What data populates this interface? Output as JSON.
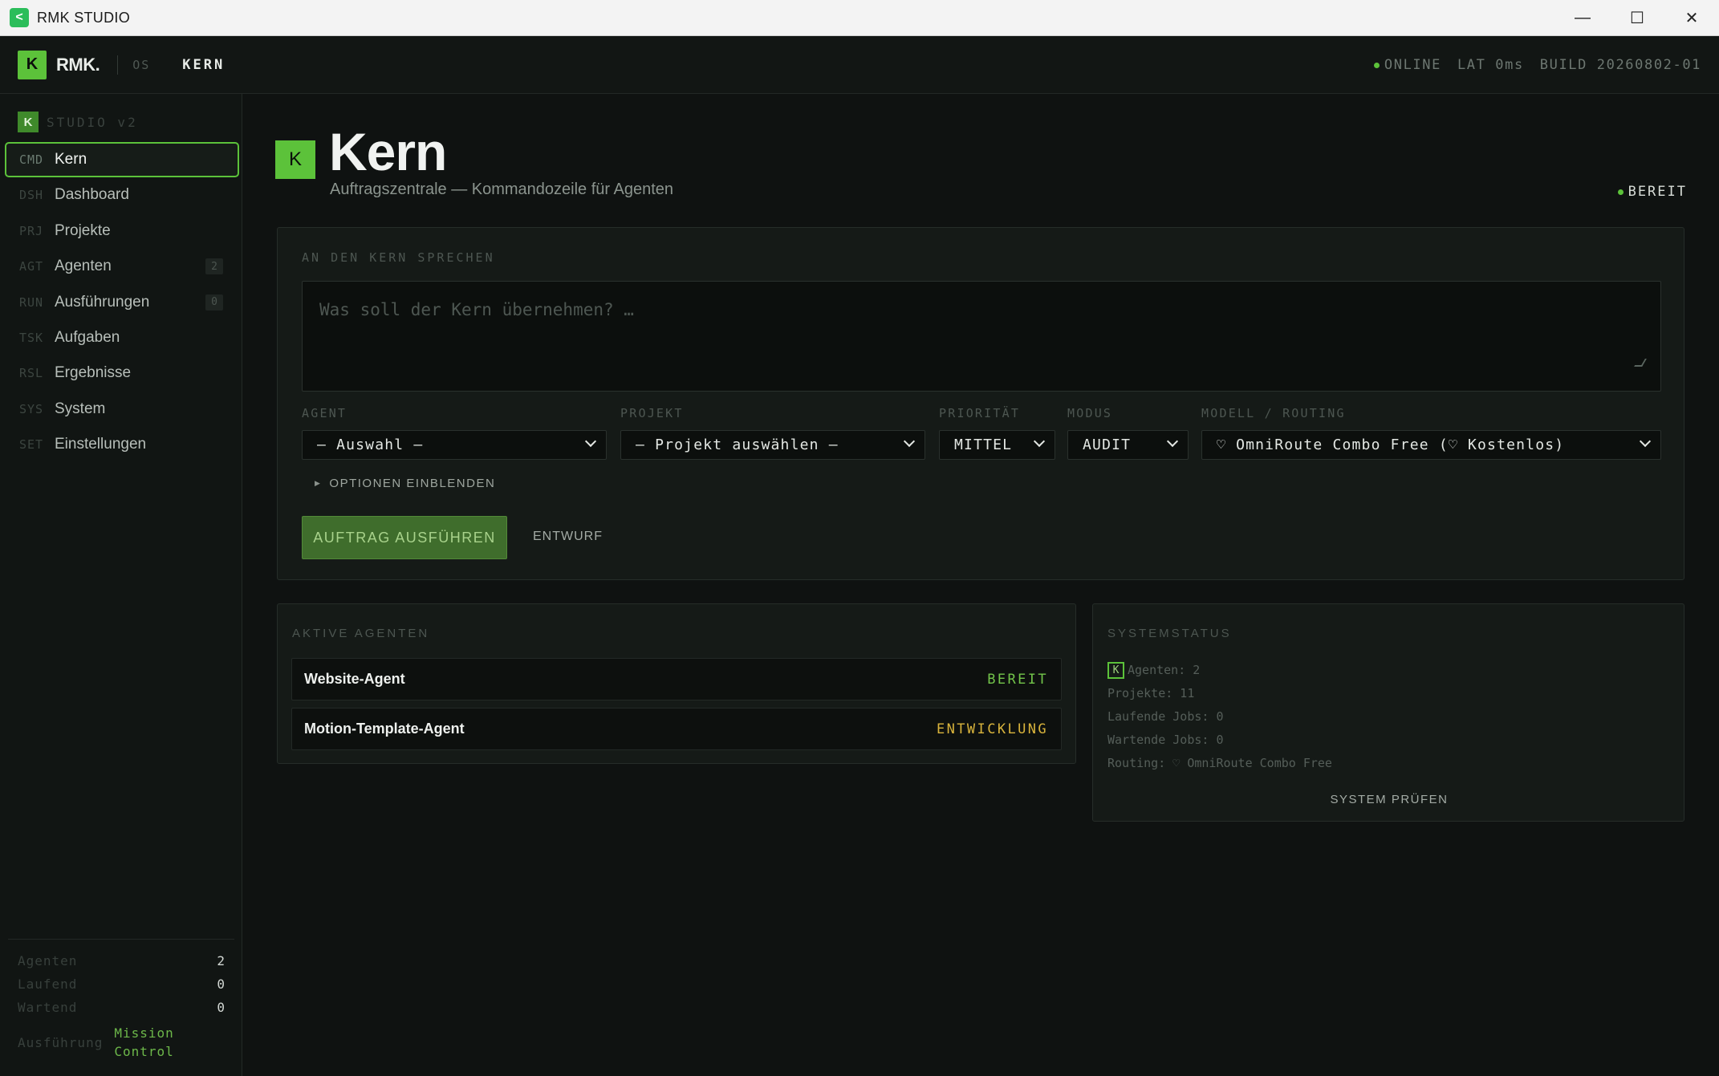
{
  "window": {
    "title": "RMK STUDIO",
    "minimize": "—",
    "maximize": "☐",
    "close": "✕"
  },
  "appbar": {
    "logo_letter": "K",
    "logo_text": "RMK.",
    "os": "OS",
    "section": "KERN",
    "online": "ONLINE",
    "latency": "LAT 0ms",
    "build": "BUILD 20260802-01"
  },
  "sidebar": {
    "brand_letter": "K",
    "brand_text": "STUDIO v2",
    "items": [
      {
        "code": "CMD",
        "label": "Kern",
        "active": true
      },
      {
        "code": "DSH",
        "label": "Dashboard"
      },
      {
        "code": "PRJ",
        "label": "Projekte"
      },
      {
        "code": "AGT",
        "label": "Agenten",
        "badge": "2"
      },
      {
        "code": "RUN",
        "label": "Ausführungen",
        "badge": "0"
      },
      {
        "code": "TSK",
        "label": "Aufgaben"
      },
      {
        "code": "RSL",
        "label": "Ergebnisse"
      },
      {
        "code": "SYS",
        "label": "System"
      },
      {
        "code": "SET",
        "label": "Einstellungen"
      }
    ],
    "footer": {
      "agents_label": "Agenten",
      "agents_value": "2",
      "running_label": "Laufend",
      "running_value": "0",
      "waiting_label": "Wartend",
      "waiting_value": "0",
      "exec_label": "Ausführung",
      "exec_value_1": "Mission",
      "exec_value_2": "Control"
    }
  },
  "hero": {
    "icon_letter": "K",
    "title": "Kern",
    "subtitle": "Auftragszentrale — Kommandozeile für Agenten",
    "status": "BEREIT"
  },
  "command": {
    "label": "AN DEN KERN SPRECHEN",
    "placeholder": "Was soll der Kern übernehmen? …",
    "agent_label": "AGENT",
    "agent_value": "— Auswahl —",
    "project_label": "PROJEKT",
    "project_value": "— Projekt auswählen —",
    "priority_label": "PRIORITÄT",
    "priority_value": "MITTEL",
    "mode_label": "MODUS",
    "mode_value": "AUDIT",
    "model_label": "MODELL / ROUTING",
    "model_value": "♡ OmniRoute Combo Free (♡ Kostenlos)",
    "options_toggle": "OPTIONEN EINBLENDEN",
    "run_button": "AUFTRAG AUSFÜHREN",
    "draft_button": "ENTWURF"
  },
  "agents": {
    "label": "AKTIVE AGENTEN",
    "rows": [
      {
        "name": "Website-Agent",
        "status": "BEREIT",
        "color": "#72c44a"
      },
      {
        "name": "Motion-Template-Agent",
        "status": "ENTWICKLUNG",
        "color": "#d9b43c"
      }
    ]
  },
  "system": {
    "label": "SYSTEMSTATUS",
    "icon_letter": "K",
    "agents": "Agenten: 2",
    "projects": "Projekte: 11",
    "running": "Laufende Jobs: 0",
    "waiting": "Wartende Jobs: 0",
    "routing": "Routing: ♡ OmniRoute Combo Free",
    "check_button": "SYSTEM PRÜFEN"
  }
}
